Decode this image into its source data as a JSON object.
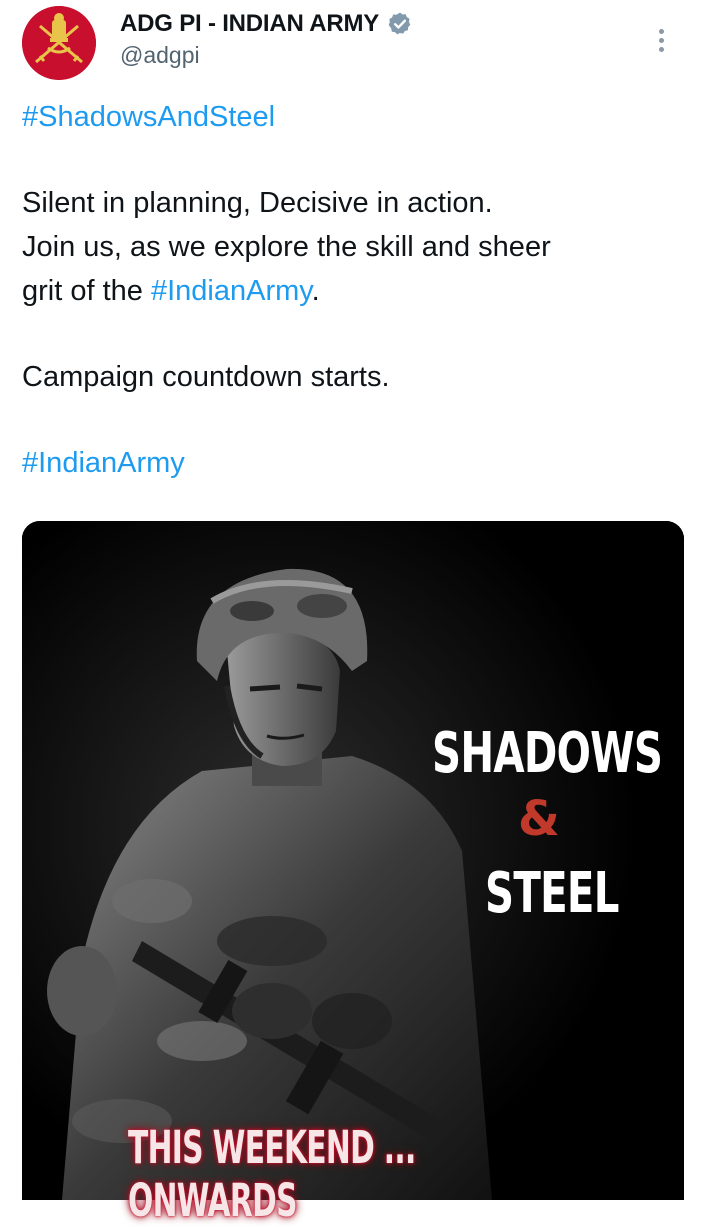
{
  "post": {
    "display_name": "ADG PI - INDIAN ARMY",
    "handle": "@adgpi",
    "hashtag_top": "#ShadowsAndSteel",
    "line1": "Silent in planning, Decisive in action.",
    "line2": "Join us, as we explore the skill and sheer",
    "line3_prefix": "grit of the ",
    "line3_link": "#IndianArmy",
    "line3_suffix": ".",
    "line4": "Campaign countdown starts.",
    "hashtag_bottom": "#IndianArmy"
  },
  "media": {
    "title_line1": "SHADOWS",
    "title_amp": "&",
    "title_line2": "STEEL",
    "banner": "THIS WEEKEND ... ONWARDS"
  },
  "icons": {
    "avatar": "army-emblem-icon",
    "verified": "verified-badge-icon",
    "more": "more-options-icon"
  },
  "colors": {
    "link": "#1d9bf0",
    "avatar_bg": "#c8102e",
    "verified": "#829aab",
    "amp": "#c0392b",
    "banner_glow": "#c9102a"
  }
}
